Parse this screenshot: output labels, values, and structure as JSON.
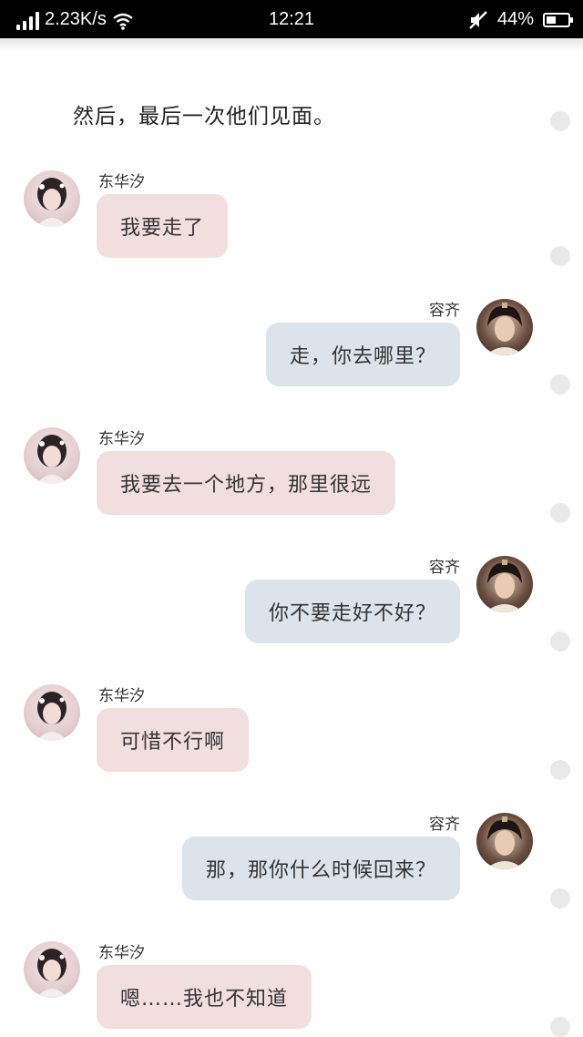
{
  "status_bar": {
    "network_speed": "2.23K/s",
    "time": "12:21",
    "battery_percent": "44%",
    "battery_level": 0.44,
    "icons": [
      "signal-icon",
      "wifi-icon",
      "mute-icon",
      "battery-icon"
    ]
  },
  "intro": "然后，最后一次他们见面。",
  "messages": [
    {
      "side": "left",
      "name": "东华汐",
      "text": "我要走了"
    },
    {
      "side": "right",
      "name": "容齐",
      "text": "走，你去哪里？"
    },
    {
      "side": "left",
      "name": "东华汐",
      "text": "我要去一个地方，那里很远"
    },
    {
      "side": "right",
      "name": "容齐",
      "text": "你不要走好不好？"
    },
    {
      "side": "left",
      "name": "东华汐",
      "text": "可惜不行啊"
    },
    {
      "side": "right",
      "name": "容齐",
      "text": "那，那你什么时候回来？"
    },
    {
      "side": "left",
      "name": "东华汐",
      "text": "嗯……我也不知道"
    }
  ],
  "colors": {
    "left_bubble": "#f1dfe0",
    "right_bubble": "#dde3ea",
    "status_bar": "#000000"
  }
}
